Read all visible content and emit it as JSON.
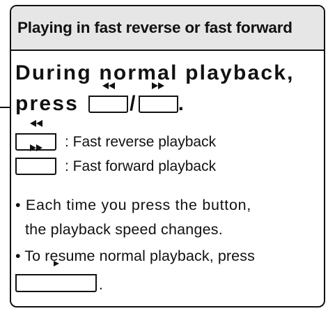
{
  "card": {
    "title": "Playing in fast reverse or fast forward"
  },
  "heading": {
    "line1": "During normal playback,",
    "line2_prefix": "press",
    "separator": "/",
    "terminator": "."
  },
  "buttons": {
    "fast_reverse_icon": "fast-reverse-icon",
    "fast_forward_icon": "fast-forward-icon",
    "play_icon": "play-icon"
  },
  "descriptions": {
    "fast_reverse": ": Fast reverse playback",
    "fast_forward": ": Fast forward playback"
  },
  "notes": {
    "note1_line1": "• Each time you press the button,",
    "note1_line2": "the playback speed changes.",
    "note2_line1": "• To resume normal playback, press",
    "note2_end": "."
  }
}
